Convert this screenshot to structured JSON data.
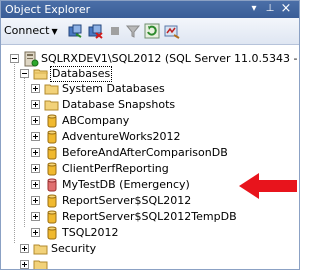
{
  "panel": {
    "title": "Object Explorer",
    "pin_glyph": "▾",
    "autohide_glyph": "⊥",
    "close_glyph": "×"
  },
  "toolbar": {
    "connect_label": "Connect",
    "connect_arrow": "▼"
  },
  "tree": {
    "server": "SQLRXDEV1\\SQL2012 (SQL Server 11.0.5343 -",
    "databases_folder": "Databases",
    "items": [
      {
        "label": "System Databases",
        "icon": "folder-icon"
      },
      {
        "label": "Database Snapshots",
        "icon": "folder-icon"
      },
      {
        "label": "ABCompany",
        "icon": "database-icon"
      },
      {
        "label": "AdventureWorks2012",
        "icon": "database-icon"
      },
      {
        "label": "BeforeAndAfterComparisonDB",
        "icon": "database-icon"
      },
      {
        "label": "ClientPerfReporting",
        "icon": "database-icon"
      },
      {
        "label": "MyTestDB (Emergency)",
        "icon": "database-emergency-icon"
      },
      {
        "label": "ReportServer$SQL2012",
        "icon": "database-icon"
      },
      {
        "label": "ReportServer$SQL2012TempDB",
        "icon": "database-icon"
      },
      {
        "label": "TSQL2012",
        "icon": "database-icon"
      }
    ],
    "security_folder": "Security"
  },
  "colors": {
    "folder": "#f2d27a",
    "database": "#f0b92f",
    "emergency_database": "#e07070",
    "arrow": "#e8141c",
    "titlebar": "#4b6fa8"
  }
}
